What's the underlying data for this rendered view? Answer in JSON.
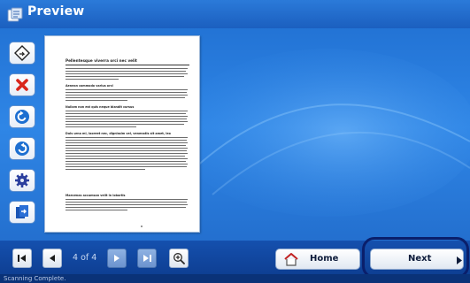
{
  "window": {
    "title": "Preview"
  },
  "tools": [
    {
      "name": "rotate-select-tool",
      "icon": "diamond-arrow-icon"
    },
    {
      "name": "delete-tool",
      "icon": "x-icon"
    },
    {
      "name": "rotate-left-tool",
      "icon": "rotate-left-icon"
    },
    {
      "name": "rotate-right-tool",
      "icon": "rotate-right-icon"
    },
    {
      "name": "settings-tool",
      "icon": "gear-icon"
    },
    {
      "name": "export-tool",
      "icon": "export-icon"
    }
  ],
  "preview": {
    "heading": "Pellentesque viverra orci nec velit",
    "sections": [
      "Aenean commodo varius orci",
      "Nullam non est quis neque blandit cursus",
      "Duis urna mi, laoreet nec, dignissim vel, venenatis sit amet, leo",
      "Maecenas accumsan velit in lobortis"
    ]
  },
  "navigation": {
    "page_counter": "4 of 4",
    "zoom_icon": "magnifier-plus-icon"
  },
  "buttons": {
    "home_label": "Home",
    "next_label": "Next"
  },
  "status": {
    "text": "Scanning Complete."
  },
  "colors": {
    "accent": "#1f6ed0",
    "highlight_ring": "#0a1f6b"
  }
}
